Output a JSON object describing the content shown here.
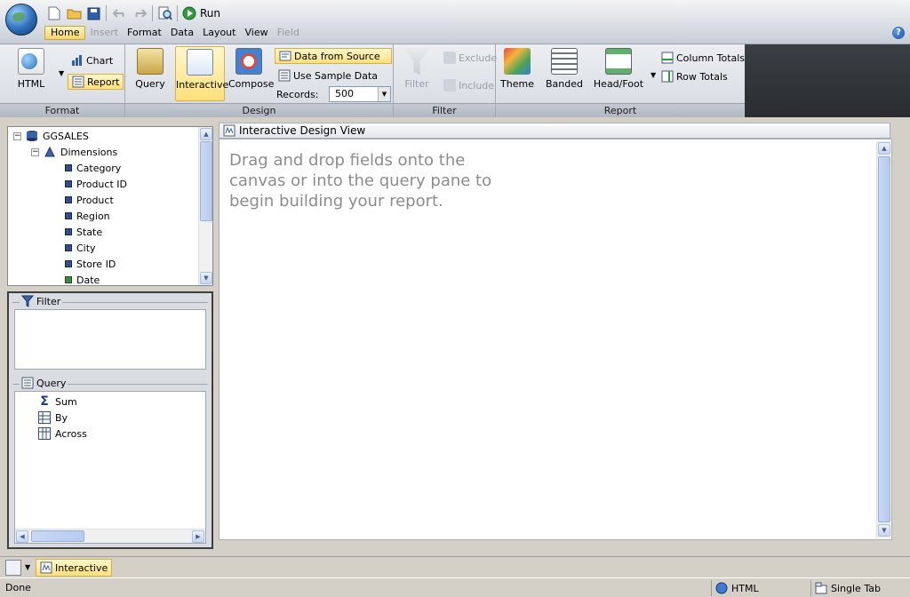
{
  "toolbar": {
    "run_label": "Run"
  },
  "menu": {
    "items": [
      {
        "label": "Home",
        "state": "active"
      },
      {
        "label": "Insert",
        "state": "disabled"
      },
      {
        "label": "Format",
        "state": "normal"
      },
      {
        "label": "Data",
        "state": "normal"
      },
      {
        "label": "Layout",
        "state": "normal"
      },
      {
        "label": "View",
        "state": "normal"
      },
      {
        "label": "Field",
        "state": "disabled"
      }
    ]
  },
  "ribbon": {
    "format": {
      "label": "Format",
      "html": "HTML",
      "chart": "Chart",
      "report": "Report"
    },
    "design": {
      "label": "Design",
      "query": "Query",
      "interactive": "Interactive",
      "compose": "Compose",
      "data_from_source": "Data from Source",
      "use_sample_data": "Use Sample Data",
      "records_label": "Records:",
      "records_value": "500"
    },
    "filter": {
      "label": "Filter",
      "filter": "Filter",
      "exclude": "Exclude",
      "include": "Include"
    },
    "report": {
      "label": "Report",
      "theme": "Theme",
      "banded": "Banded",
      "headfoot": "Head/Foot",
      "column_totals": "Column Totals",
      "row_totals": "Row Totals"
    }
  },
  "tree": {
    "root": "GGSALES",
    "folder": "Dimensions",
    "fields": [
      "Category",
      "Product ID",
      "Product",
      "Region",
      "State",
      "City",
      "Store ID",
      "Date"
    ]
  },
  "filter_pane": {
    "title": "Filter"
  },
  "query_pane": {
    "title": "Query",
    "items": [
      "Sum",
      "By",
      "Across"
    ]
  },
  "canvas": {
    "title": "Interactive Design View",
    "hint": "Drag and drop fields onto the canvas or into the query pane to begin building your report."
  },
  "tabs": {
    "interactive": "Interactive"
  },
  "status": {
    "text": "Done",
    "format": "HTML",
    "mode": "Single Tab"
  },
  "colors": {
    "accent": "#ffe07a",
    "ribbon_dark": "#2a2c30",
    "hint_text": "#8c8c8c"
  }
}
